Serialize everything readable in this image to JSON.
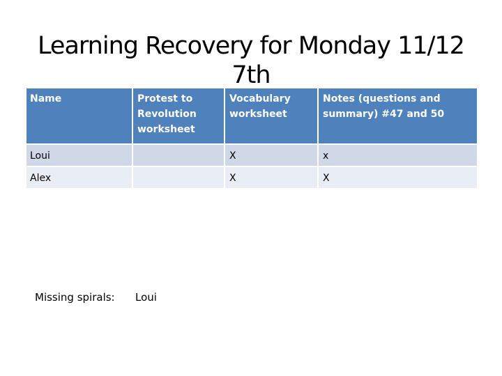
{
  "slide": {
    "title_line1": "Learning Recovery for Monday 11/12",
    "title_line2": "7th"
  },
  "table": {
    "headers": [
      "Name",
      "Protest to Revolution worksheet",
      "Vocabulary worksheet",
      "Notes (questions and summary) #47 and 50"
    ],
    "rows": [
      [
        "Loui",
        "",
        "X",
        "x"
      ],
      [
        "Alex",
        "",
        "X",
        "X"
      ]
    ]
  },
  "missing_spirals": {
    "label": "Missing spirals:",
    "value": "Loui"
  },
  "colors": {
    "header_bg": "#4f81bd",
    "row_odd_bg": "#d0d8e8",
    "row_even_bg": "#e9edf4"
  }
}
